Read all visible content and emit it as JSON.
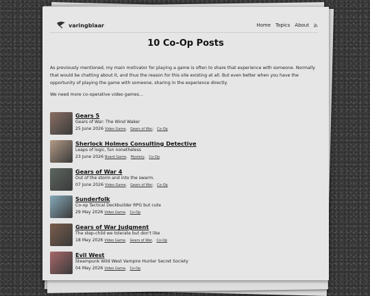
{
  "site": {
    "name": "varingblaar"
  },
  "nav": {
    "home": "Home",
    "topics": "Topics",
    "about": "About"
  },
  "page_title": "10 Co-Op Posts",
  "intro": {
    "p1": "As previously mentioned, my main motivator for playing a game is often to share that experience with someone. Normally that would be chatting about it, and thus the reason for this site existing at all. But even better when you have the opportunity of playing the game with someone, sharing in the experience directly.",
    "p2": "We need more co-operative video games..."
  },
  "posts": [
    {
      "title": "Gears 5",
      "subtitle": "Gears of War: The Wind Waker",
      "date": "25 June 2026",
      "tags": [
        "Video Game",
        "Gears of War",
        "Co-Op"
      ],
      "thumb_color": "#8a6f63"
    },
    {
      "title": "Sherlock Holmes Consulting Detective",
      "subtitle": "Leaps of logic, fun nonetheless",
      "date": "23 June 2026",
      "tags": [
        "Board Game",
        "Mystery",
        "Co-Op"
      ],
      "thumb_color": "#b39a86"
    },
    {
      "title": "Gears of War 4",
      "subtitle": "Out of the storm and into the swarm.",
      "date": "07 June 2026",
      "tags": [
        "Video Game",
        "Gears of War",
        "Co-Op"
      ],
      "thumb_color": "#5d6660"
    },
    {
      "title": "Sunderfolk",
      "subtitle": "Co-op Tactical Deckbuilder RPG but cute",
      "date": "29 May 2026",
      "tags": [
        "Video Game",
        "Co-Op"
      ],
      "thumb_color": "#86a9b9"
    },
    {
      "title": "Gears of War Judgment",
      "subtitle": "The step-child we tolerate but don't like",
      "date": "18 May 2026",
      "tags": [
        "Video Game",
        "Gears of War",
        "Co-Op"
      ],
      "thumb_color": "#7a5c4b"
    },
    {
      "title": "Evil West",
      "subtitle": "Steampunk Wild West Vampire Hunter Secret Society",
      "date": "04 May 2026",
      "tags": [
        "Video Game",
        "Co-Op"
      ],
      "thumb_color": "#a8686a"
    }
  ]
}
